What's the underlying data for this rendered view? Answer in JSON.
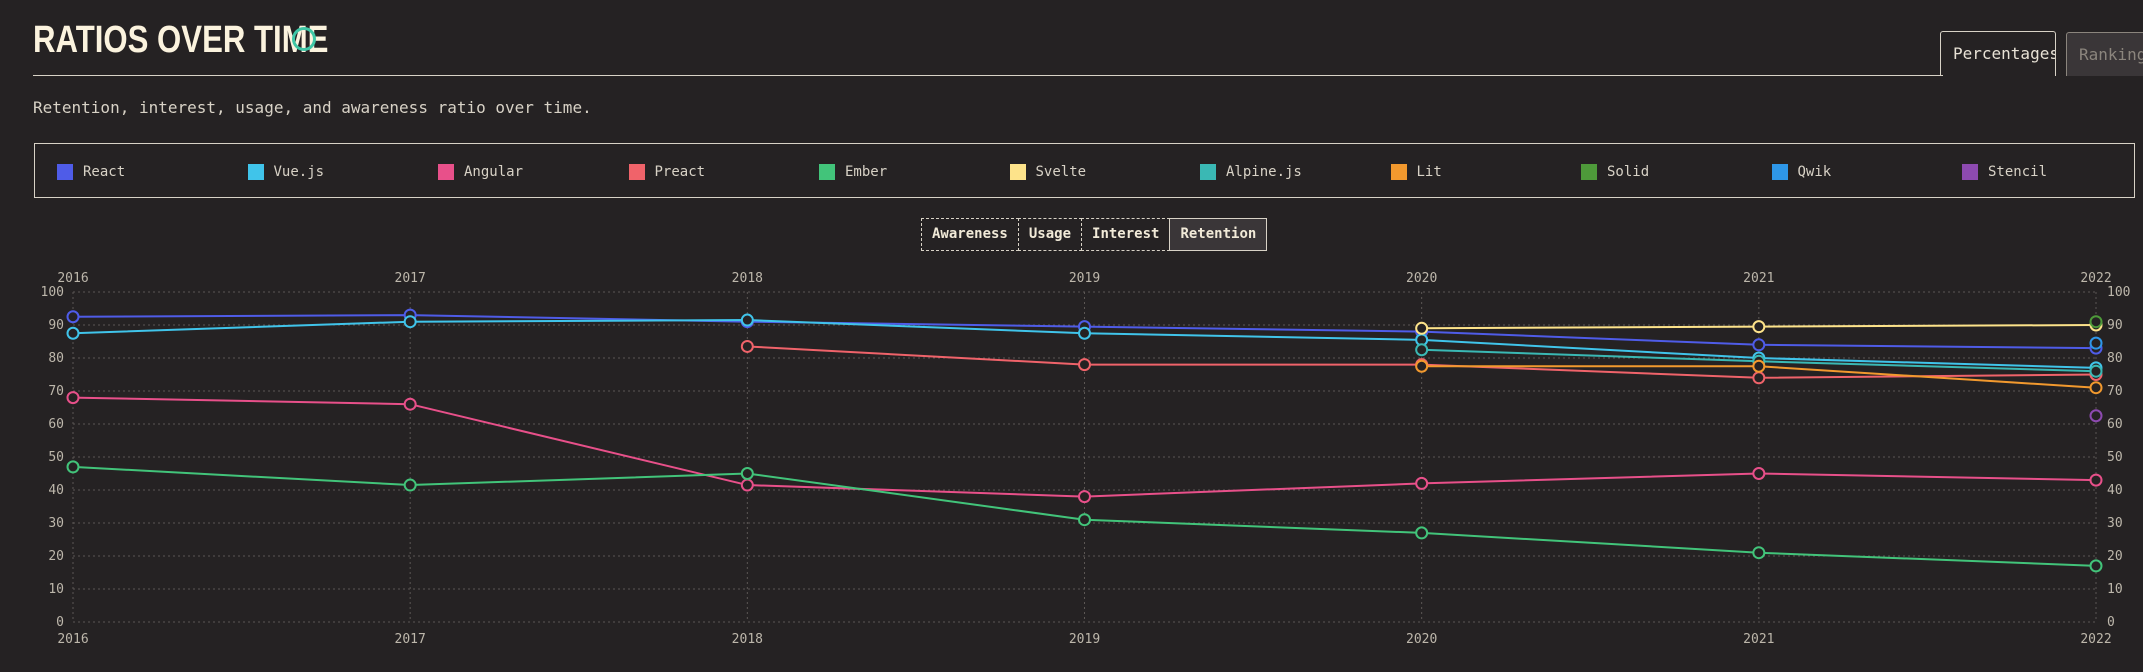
{
  "header": {
    "title": "RATIOS OVER TIME",
    "subtitle": "Retention, interest, usage, and awareness ratio over time.",
    "tabs": [
      {
        "label": "Percentages",
        "active": true
      },
      {
        "label": "Rankings",
        "active": false
      }
    ]
  },
  "legend": [
    {
      "label": "React",
      "color": "#4f5ce8"
    },
    {
      "label": "Vue.js",
      "color": "#40c4ea"
    },
    {
      "label": "Angular",
      "color": "#e8508a"
    },
    {
      "label": "Preact",
      "color": "#f0636a"
    },
    {
      "label": "Ember",
      "color": "#42c47a"
    },
    {
      "label": "Svelte",
      "color": "#fde38a"
    },
    {
      "label": "Alpine.js",
      "color": "#3ab8b4"
    },
    {
      "label": "Lit",
      "color": "#f2992e"
    },
    {
      "label": "Solid",
      "color": "#4e9a3a"
    },
    {
      "label": "Qwik",
      "color": "#2e97e8"
    },
    {
      "label": "Stencil",
      "color": "#8d4ab0"
    }
  ],
  "filters": [
    {
      "label": "Awareness",
      "active": false
    },
    {
      "label": "Usage",
      "active": false
    },
    {
      "label": "Interest",
      "active": false
    },
    {
      "label": "Retention",
      "active": true
    }
  ],
  "chart_data": {
    "type": "line",
    "x": [
      2016,
      2017,
      2018,
      2019,
      2020,
      2021,
      2022
    ],
    "ylim": [
      0,
      100
    ],
    "yticks": [
      0,
      10,
      20,
      30,
      40,
      50,
      60,
      70,
      80,
      90,
      100
    ],
    "grid": true,
    "series": [
      {
        "name": "React",
        "color": "#4f5ce8",
        "values": [
          92.5,
          93,
          91,
          89.5,
          88,
          84,
          83
        ]
      },
      {
        "name": "Vue.js",
        "color": "#40c4ea",
        "values": [
          87.5,
          91,
          91.5,
          87.5,
          85.5,
          80,
          77
        ]
      },
      {
        "name": "Angular",
        "color": "#e8508a",
        "values": [
          68,
          66,
          41.5,
          38,
          42,
          45,
          43
        ]
      },
      {
        "name": "Preact",
        "color": "#f0636a",
        "values": [
          null,
          null,
          83.5,
          78,
          78,
          74,
          75
        ]
      },
      {
        "name": "Ember",
        "color": "#42c47a",
        "values": [
          47,
          41.5,
          45,
          31,
          27,
          21,
          17
        ]
      },
      {
        "name": "Svelte",
        "color": "#fde38a",
        "values": [
          null,
          null,
          null,
          null,
          89,
          89.5,
          90
        ]
      },
      {
        "name": "Alpine.js",
        "color": "#3ab8b4",
        "values": [
          null,
          null,
          null,
          null,
          82.5,
          79,
          76
        ]
      },
      {
        "name": "Lit",
        "color": "#f2992e",
        "values": [
          null,
          null,
          null,
          null,
          77.5,
          77.5,
          71
        ]
      },
      {
        "name": "Solid",
        "color": "#4e9a3a",
        "values": [
          null,
          null,
          null,
          null,
          null,
          null,
          91
        ]
      },
      {
        "name": "Qwik",
        "color": "#2e97e8",
        "values": [
          null,
          null,
          null,
          null,
          null,
          null,
          84.5
        ]
      },
      {
        "name": "Stencil",
        "color": "#8d4ab0",
        "values": [
          null,
          null,
          null,
          null,
          null,
          null,
          62.5
        ]
      }
    ]
  }
}
